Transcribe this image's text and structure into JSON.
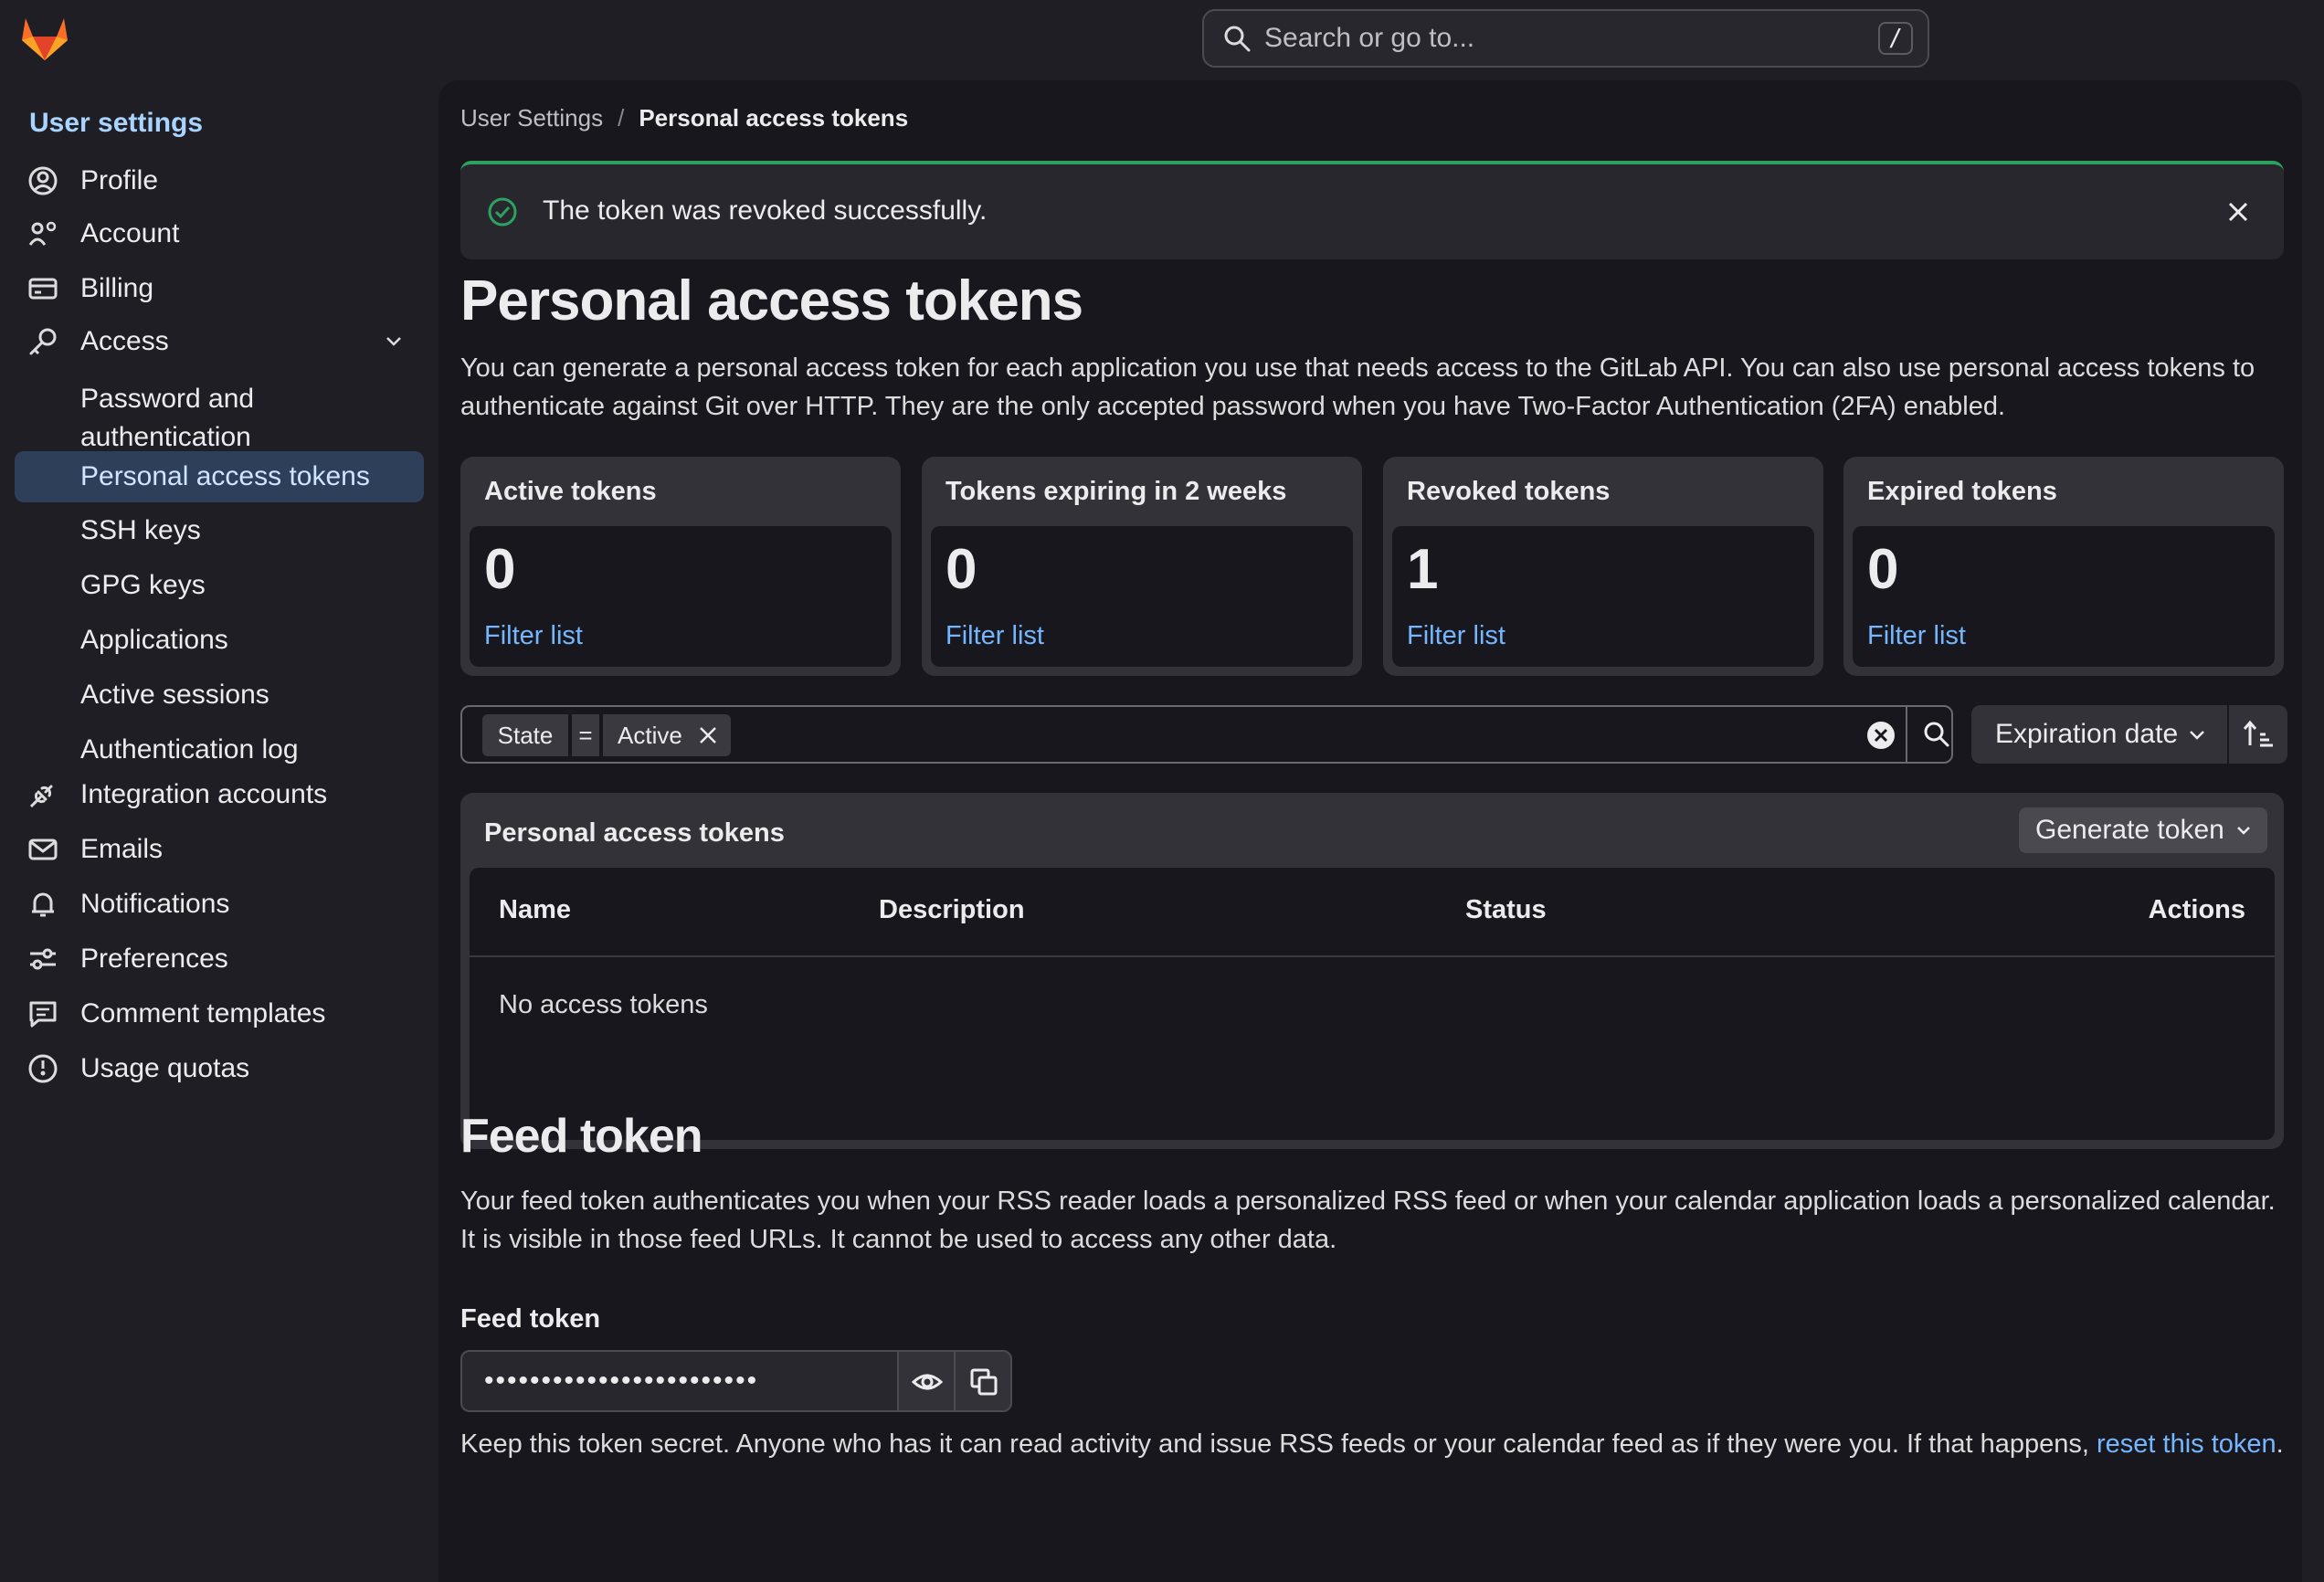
{
  "search": {
    "placeholder": "Search or go to...",
    "shortcut": "/"
  },
  "sidebar": {
    "title": "User settings",
    "items": [
      {
        "label": "Profile"
      },
      {
        "label": "Account"
      },
      {
        "label": "Billing"
      },
      {
        "label": "Access"
      },
      {
        "label": "Password and"
      },
      {
        "label": "authentication"
      },
      {
        "label": "Personal access tokens"
      },
      {
        "label": "SSH keys"
      },
      {
        "label": "GPG keys"
      },
      {
        "label": "Applications"
      },
      {
        "label": "Active sessions"
      },
      {
        "label": "Authentication log"
      },
      {
        "label": "Integration accounts"
      },
      {
        "label": "Emails"
      },
      {
        "label": "Notifications"
      },
      {
        "label": "Preferences"
      },
      {
        "label": "Comment templates"
      },
      {
        "label": "Usage quotas"
      }
    ]
  },
  "breadcrumb": {
    "parent": "User Settings",
    "separator": "/",
    "current": "Personal access tokens"
  },
  "alert": {
    "message": "The token was revoked successfully."
  },
  "page": {
    "title": "Personal access tokens",
    "description": "You can generate a personal access token for each application you use that needs access to the GitLab API. You can also use personal access tokens to authenticate against Git over HTTP. They are the only accepted password when you have Two-Factor Authentication (2FA) enabled."
  },
  "stats": [
    {
      "title": "Active tokens",
      "value": "0",
      "link": "Filter list"
    },
    {
      "title": "Tokens expiring in 2 weeks",
      "value": "0",
      "link": "Filter list"
    },
    {
      "title": "Revoked tokens",
      "value": "1",
      "link": "Filter list"
    },
    {
      "title": "Expired tokens",
      "value": "0",
      "link": "Filter list"
    }
  ],
  "filter": {
    "field": "State",
    "operator": "=",
    "value": "Active"
  },
  "sort": {
    "label": "Expiration date"
  },
  "tokens_table": {
    "title": "Personal access tokens",
    "generate_label": "Generate token",
    "columns": [
      "Name",
      "Description",
      "Status",
      "Actions"
    ],
    "empty_text": "No access tokens"
  },
  "feed": {
    "title": "Feed token",
    "description": "Your feed token authenticates you when your RSS reader loads a personalized RSS feed or when your calendar application loads a personalized calendar. It is visible in those feed URLs. It cannot be used to access any other data.",
    "label": "Feed token",
    "masked_value": "••••••••••••••••••••••••",
    "help_prefix": "Keep this token secret. Anyone who has it can read activity and issue RSS feeds or your calendar feed as if they were you. If that happens, ",
    "help_link": "reset this token",
    "help_suffix": "."
  },
  "colors": {
    "accent": "#75b7ff",
    "success": "#2da160",
    "active_nav": "#2e3f5a"
  }
}
